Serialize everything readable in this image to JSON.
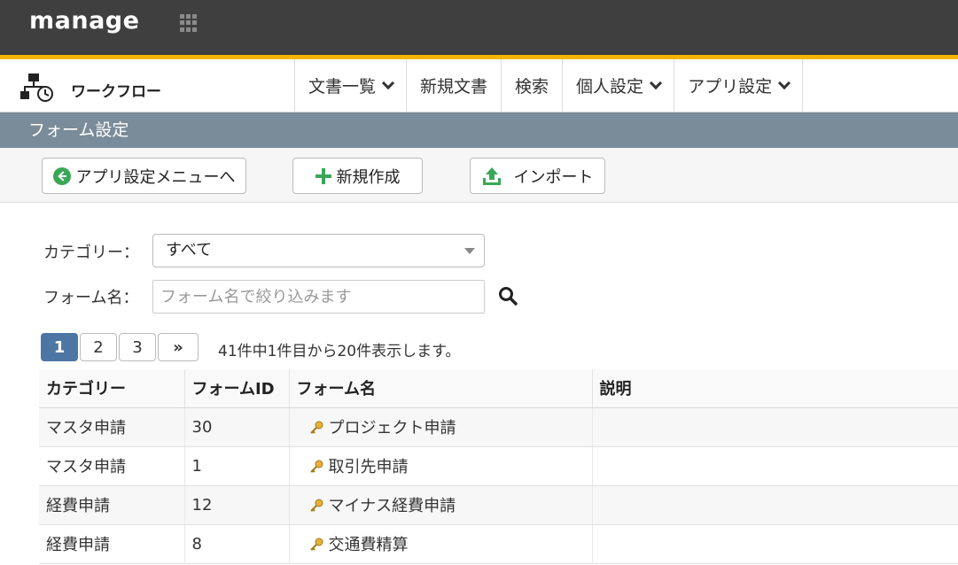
{
  "brand": {
    "logo_text": "manage"
  },
  "app": {
    "title": "ワークフロー"
  },
  "nav": [
    {
      "label": "文書一覧",
      "dropdown": true
    },
    {
      "label": "新規文書",
      "dropdown": false
    },
    {
      "label": "検索",
      "dropdown": false
    },
    {
      "label": "個人設定",
      "dropdown": true
    },
    {
      "label": "アプリ設定",
      "dropdown": true
    }
  ],
  "section": {
    "title": "フォーム設定"
  },
  "toolbar": {
    "back_label": "アプリ設定メニューへ",
    "new_label": "新規作成",
    "import_label": "インポート"
  },
  "filters": {
    "category_label": "カテゴリー：",
    "category_value": "すべて",
    "form_name_label": "フォーム名：",
    "form_name_placeholder": "フォーム名で絞り込みます"
  },
  "pagination": {
    "pages": [
      "1",
      "2",
      "3"
    ],
    "current": "1",
    "next_label": "»",
    "info": "41件中1件目から20件表示します。"
  },
  "table": {
    "columns": [
      "カテゴリー",
      "フォームID",
      "フォーム名",
      "説明"
    ],
    "rows": [
      {
        "category": "マスタ申請",
        "form_id": "30",
        "form_name": "プロジェクト申請",
        "description": ""
      },
      {
        "category": "マスタ申請",
        "form_id": "1",
        "form_name": "取引先申請",
        "description": ""
      },
      {
        "category": "経費申請",
        "form_id": "12",
        "form_name": "マイナス経費申請",
        "description": ""
      },
      {
        "category": "経費申請",
        "form_id": "8",
        "form_name": "交通費精算",
        "description": ""
      }
    ]
  },
  "colors": {
    "topbar": "#3f3f3f",
    "accent": "#f5b400",
    "section_bar": "#7a8b99",
    "active_page": "#4d76a5",
    "green_icon": "#3aa757"
  }
}
